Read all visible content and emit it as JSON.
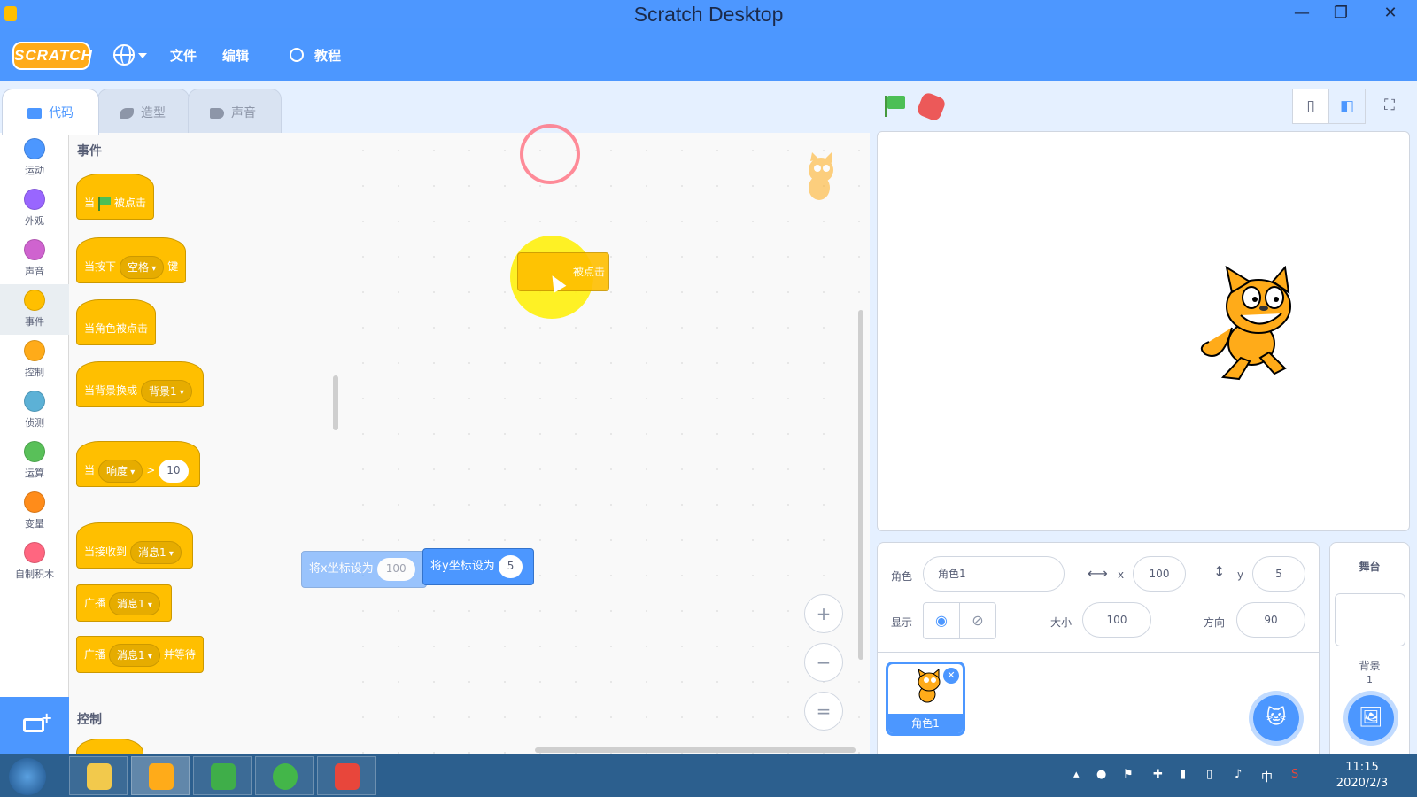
{
  "window": {
    "title": "Scratch Desktop"
  },
  "menubar": {
    "logo": "SCRATCH",
    "file": "文件",
    "edit": "编辑",
    "tutorials": "教程"
  },
  "tabs": [
    {
      "label": "代码"
    },
    {
      "label": "造型"
    },
    {
      "label": "声音"
    }
  ],
  "categories": [
    {
      "label": "运动",
      "color": "#4c97ff"
    },
    {
      "label": "外观",
      "color": "#9966ff"
    },
    {
      "label": "声音",
      "color": "#cf63cf"
    },
    {
      "label": "事件",
      "color": "#ffbf00"
    },
    {
      "label": "控制",
      "color": "#ffab19"
    },
    {
      "label": "侦测",
      "color": "#5cb1d6"
    },
    {
      "label": "运算",
      "color": "#59c059"
    },
    {
      "label": "变量",
      "color": "#ff8c1a"
    },
    {
      "label": "自制积木",
      "color": "#ff6680"
    }
  ],
  "palette": {
    "events_title": "事件",
    "control_title": "控制",
    "blocks": {
      "when_flag_pre": "当",
      "when_flag_post": "被点击",
      "when_key_pre": "当按下",
      "when_key_value": "空格",
      "when_key_post": "键",
      "when_sprite_clicked": "当角色被点击",
      "when_backdrop_pre": "当背景换成",
      "when_backdrop_value": "背景1",
      "when_gt_pre": "当",
      "when_gt_value": "响度",
      "when_gt_op": ">",
      "when_gt_num": "10",
      "when_receive_pre": "当接收到",
      "when_receive_value": "消息1",
      "broadcast_pre": "广播",
      "broadcast_value": "消息1",
      "broadcast_wait_pre": "广播",
      "broadcast_wait_value": "消息1",
      "broadcast_wait_post": "并等待"
    }
  },
  "workspace": {
    "set_x_label": "将x坐标设为",
    "set_x_value": "100",
    "set_y_label": "将y坐标设为",
    "set_y_value": "5",
    "dragging_label": "被点击"
  },
  "sprite_info": {
    "sprite_label": "角色",
    "sprite_name": "角色1",
    "x_label": "x",
    "x_value": "100",
    "y_label": "y",
    "y_value": "5",
    "show_label": "显示",
    "size_label": "大小",
    "size_value": "100",
    "direction_label": "方向",
    "direction_value": "90"
  },
  "sprite_list": [
    {
      "name": "角色1"
    }
  ],
  "stage_panel": {
    "title": "舞台",
    "backdrops_label": "背景",
    "backdrop_count": "1"
  },
  "taskbar": {
    "time": "11:15",
    "date": "2020/2/3",
    "ime": "中"
  }
}
